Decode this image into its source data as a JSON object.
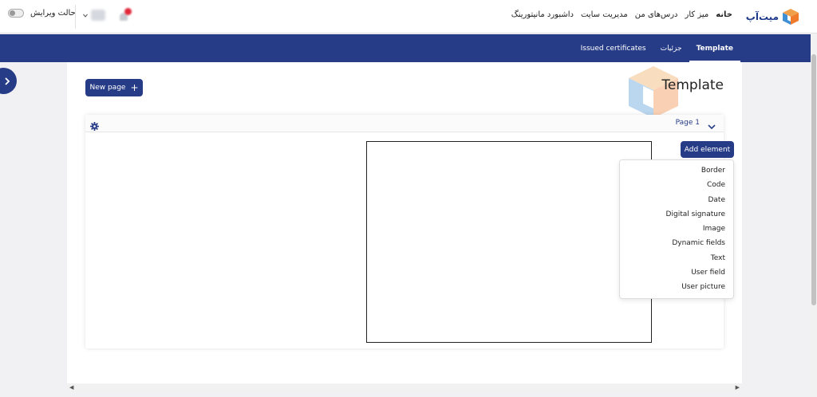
{
  "header": {
    "logo_text": "میت‌آپ",
    "nav": [
      "خانه",
      "میز کار",
      "درس‌های من",
      "مدیریت سایت",
      "داشبورد مانیتورینگ"
    ],
    "edit_mode_label": "حالت ویرایش",
    "brand_color": "#273c87"
  },
  "subnav": {
    "tabs": [
      {
        "label": "Template",
        "active": true
      },
      {
        "label": "جزئیات",
        "active": false
      },
      {
        "label": "Issued certificates",
        "active": false
      }
    ]
  },
  "main": {
    "title": "Template",
    "new_page_label": "New page",
    "page_label": "Page 1",
    "add_element_label": "Add element",
    "element_menu": [
      "Border",
      "Code",
      "Date",
      "Digital signature",
      "Image",
      "Dynamic fields",
      "Text",
      "User field",
      "User picture"
    ]
  },
  "icons": {
    "drawer": "chevron-right-icon",
    "settings": "gear-icon",
    "collapse": "chevron-down-icon",
    "add": "plus-icon",
    "notifications": "bell-icon"
  }
}
